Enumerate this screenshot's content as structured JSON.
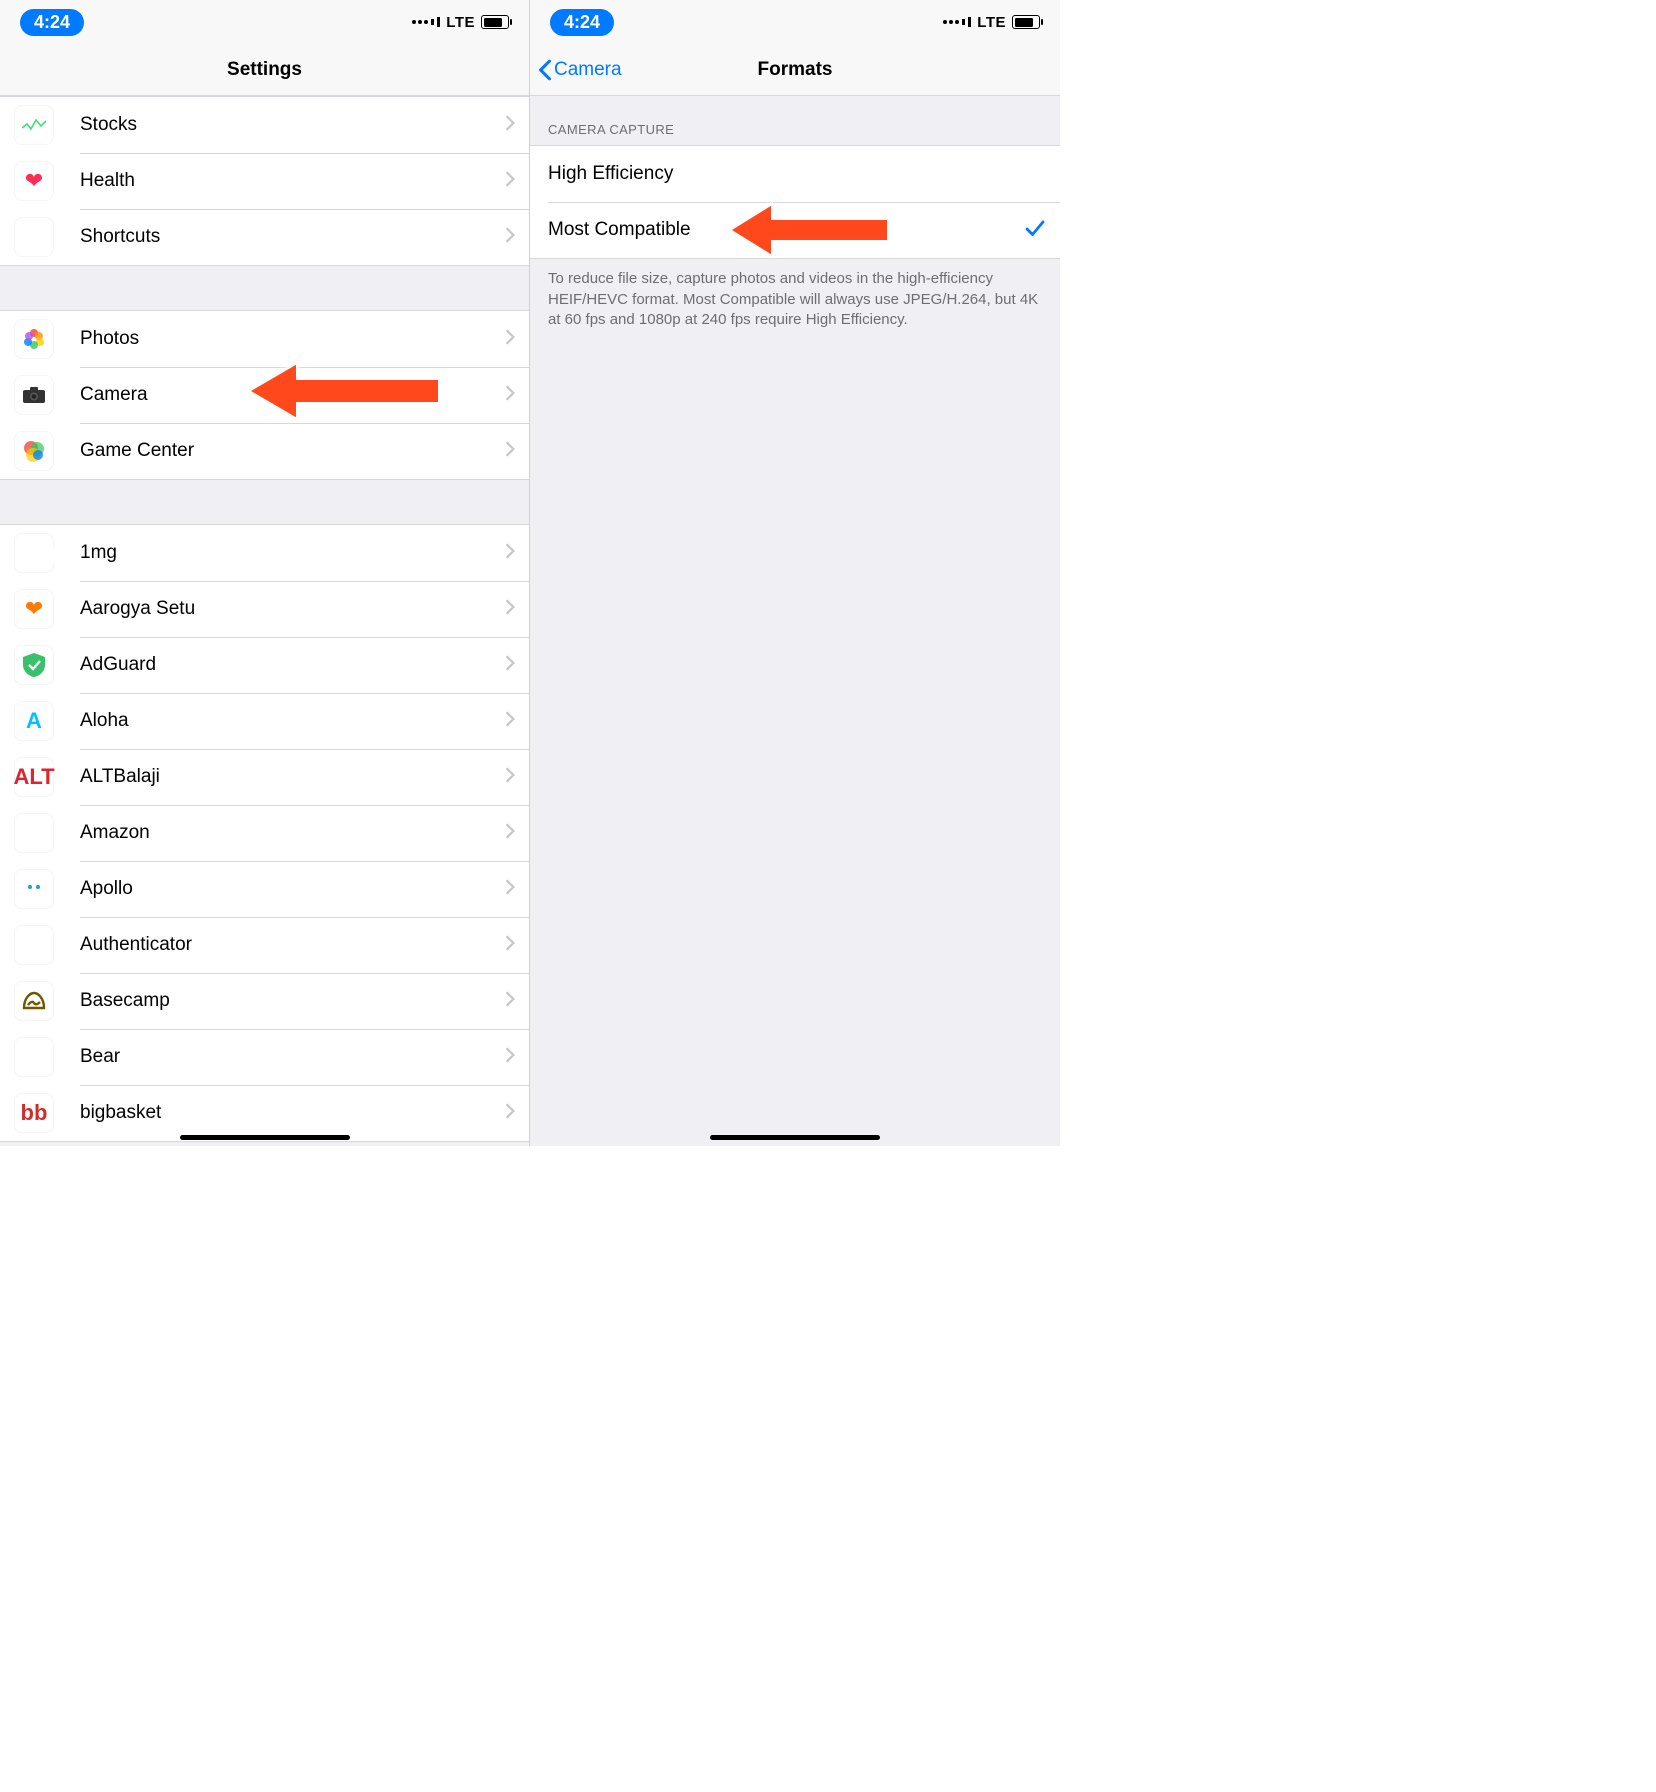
{
  "status": {
    "time": "4:24",
    "network": "LTE"
  },
  "left": {
    "title": "Settings",
    "groups": [
      [
        {
          "key": "stocks",
          "label": "Stocks"
        },
        {
          "key": "health",
          "label": "Health"
        },
        {
          "key": "shortcuts",
          "label": "Shortcuts"
        }
      ],
      [
        {
          "key": "photos",
          "label": "Photos"
        },
        {
          "key": "camera",
          "label": "Camera"
        },
        {
          "key": "gamecenter",
          "label": "Game Center"
        }
      ],
      [
        {
          "key": "1mg",
          "label": "1mg"
        },
        {
          "key": "aarogya",
          "label": "Aarogya Setu"
        },
        {
          "key": "adguard",
          "label": "AdGuard"
        },
        {
          "key": "aloha",
          "label": "Aloha"
        },
        {
          "key": "altbalaji",
          "label": "ALTBalaji"
        },
        {
          "key": "amazon",
          "label": "Amazon"
        },
        {
          "key": "apollo",
          "label": "Apollo"
        },
        {
          "key": "authenticator",
          "label": "Authenticator"
        },
        {
          "key": "basecamp",
          "label": "Basecamp"
        },
        {
          "key": "bear",
          "label": "Bear"
        },
        {
          "key": "bigbasket",
          "label": "bigbasket"
        }
      ]
    ]
  },
  "right": {
    "back": "Camera",
    "title": "Formats",
    "section_header": "CAMERA CAPTURE",
    "options": [
      {
        "label": "High Efficiency",
        "selected": false
      },
      {
        "label": "Most Compatible",
        "selected": true
      }
    ],
    "footer": "To reduce file size, capture photos and videos in the high-efficiency HEIF/HEVC format. Most Compatible will always use JPEG/H.264, but 4K at 60 fps and 1080p at 240 fps require High Efficiency."
  },
  "annotation": {
    "left_arrow_target": "camera",
    "right_arrow_target": "most_compatible",
    "arrow_color": "#ff4a1c"
  }
}
